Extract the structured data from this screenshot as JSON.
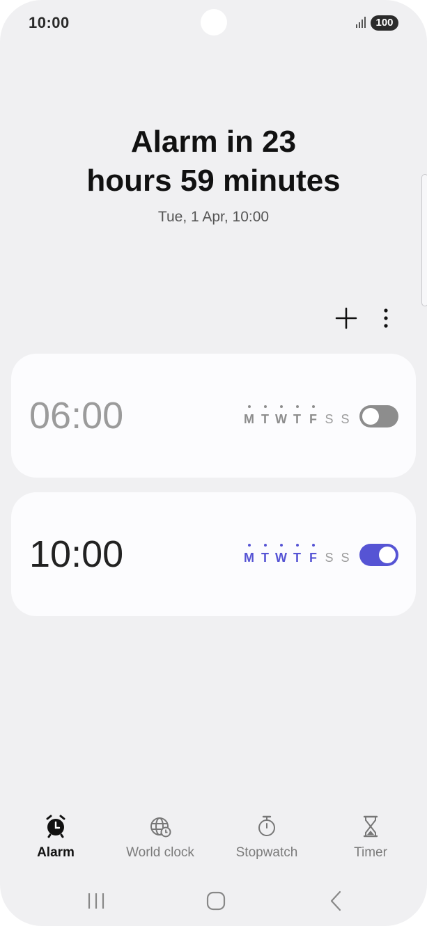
{
  "status_bar": {
    "time": "10:00",
    "battery": "100",
    "icons": [
      "signal-icon",
      "battery-icon"
    ]
  },
  "header": {
    "headline_line1": "Alarm in 23",
    "headline_line2": "hours 59 minutes",
    "next_alarm_date": "Tue, 1 Apr, 10:00"
  },
  "toolbar": {
    "icons": [
      "add-icon",
      "more-options-icon"
    ]
  },
  "alarms": [
    {
      "time": "06:00",
      "enabled": false,
      "days": [
        {
          "label": "M",
          "selected": true
        },
        {
          "label": "T",
          "selected": true
        },
        {
          "label": "W",
          "selected": true
        },
        {
          "label": "T",
          "selected": true
        },
        {
          "label": "F",
          "selected": true
        },
        {
          "label": "S",
          "selected": false
        },
        {
          "label": "S",
          "selected": false
        }
      ]
    },
    {
      "time": "10:00",
      "enabled": true,
      "days": [
        {
          "label": "M",
          "selected": true
        },
        {
          "label": "T",
          "selected": true
        },
        {
          "label": "W",
          "selected": true
        },
        {
          "label": "T",
          "selected": true
        },
        {
          "label": "F",
          "selected": true
        },
        {
          "label": "S",
          "selected": false
        },
        {
          "label": "S",
          "selected": false
        }
      ]
    }
  ],
  "bottom_nav": {
    "items": [
      {
        "label": "Alarm",
        "icon": "alarm-clock-icon",
        "active": true
      },
      {
        "label": "World clock",
        "icon": "globe-clock-icon",
        "active": false
      },
      {
        "label": "Stopwatch",
        "icon": "stopwatch-icon",
        "active": false
      },
      {
        "label": "Timer",
        "icon": "hourglass-icon",
        "active": false
      }
    ]
  },
  "system_nav": {
    "icons": [
      "recent-apps-icon",
      "home-icon",
      "back-icon"
    ]
  },
  "colors": {
    "background": "#f0f0f2",
    "card": "#fcfcfe",
    "accent": "#5654d4",
    "inactive": "#8d8d8d"
  }
}
